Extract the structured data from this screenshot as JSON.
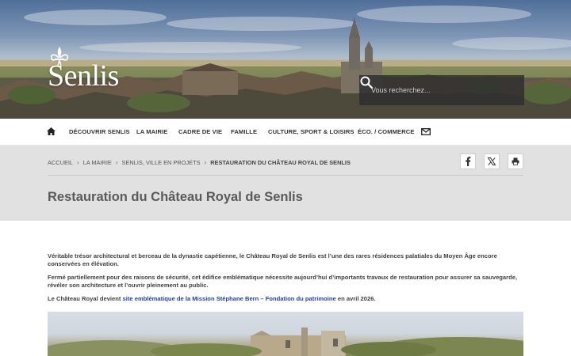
{
  "header": {
    "logo_text": "Senlis",
    "search_placeholder": "Vous recherchez..."
  },
  "nav": {
    "items": [
      {
        "label": "DÉCOUVRIR SENLIS"
      },
      {
        "label": "LA MAIRIE"
      },
      {
        "label": "CADRE DE VIE"
      },
      {
        "label": "FAMILLE"
      },
      {
        "label": "CULTURE, SPORT & LOISIRS"
      },
      {
        "label": "ÉCO. / COMMERCE"
      }
    ]
  },
  "breadcrumb": {
    "items": [
      "ACCUEIL",
      "LA MAIRIE",
      "SENLIS, VILLE EN PROJETS",
      "RESTAURATION DU CHÂTEAU ROYAL DE SENLIS"
    ],
    "separator": "›"
  },
  "page": {
    "title": "Restauration du Château Royal de Senlis"
  },
  "content": {
    "p1": "Véritable trésor architectural et berceau de la dynastie capétienne, le Château Royal de Senlis est l’une des rares résidences palatiales du Moyen Âge encore conservées en élévation.",
    "p2": "Fermé partiellement pour des raisons de sécurité, cet édifice emblématique nécessite aujourd’hui d’importants travaux de restauration pour assurer sa sauvegarde, révéler son architecture et l’ouvrir pleinement au public.",
    "p3_before": "Le Château Royal devient ",
    "p3_link": "site emblématique de la Mission Stéphane Bern – Fondation du patrimoine",
    "p3_after": " en avril 2026."
  },
  "icons": {
    "home": "home-icon",
    "mail": "mail-icon",
    "search": "search-icon",
    "facebook": "facebook-icon",
    "x": "x-icon",
    "print": "print-icon",
    "fleur": "fleur-de-lis-icon"
  },
  "colors": {
    "link": "#2340a8",
    "band": "#e1e1e1",
    "search_bg": "#2d2d2d"
  }
}
